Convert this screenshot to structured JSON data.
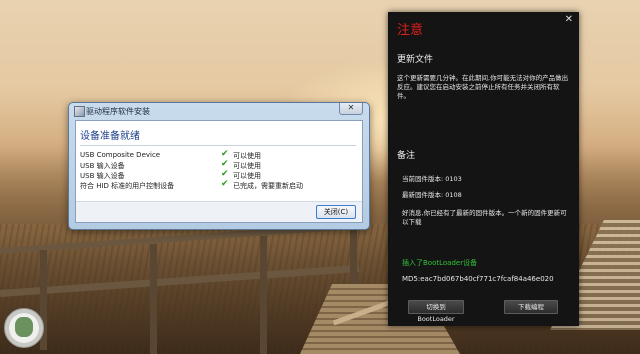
{
  "driver_dialog": {
    "title": "驱动程序软件安装",
    "close_glyph": "✕",
    "heading": "设备准备就绪",
    "devices": [
      {
        "name": "USB Composite Device",
        "status": "可以使用"
      },
      {
        "name": "USB 输入设备",
        "status": "可以使用"
      },
      {
        "name": "USB 输入设备",
        "status": "可以使用"
      },
      {
        "name": "符合 HID 标准的用户控制设备",
        "status": "已完成，需要重新启动"
      }
    ],
    "status_icon": "checkmark-icon",
    "check_glyph": "✔",
    "close_button_label": "关闭(C)"
  },
  "update_panel": {
    "title": "注意",
    "close_glyph": "✕",
    "section_update": "更新文件",
    "update_text": "这个更新需要几分钟。在此期间,你可能无法对你的产品做出反应。建议您在启动安装之前停止所有任务并关闭所有软件。",
    "section_notes": "备注",
    "current_version": "当前固件版本: 0103",
    "latest_version": "最新固件版本: 0108",
    "message": "好消息,你已经有了最新的固件版本。一个新的固件更新可以下载",
    "bootloader_status": "插入了BootLoader设备",
    "md5": "MD5:eac7bd067b40cf771c7fcaf84a46e020",
    "switch_button_label": "切换到BootLoader",
    "download_button_label": "下载编程"
  },
  "colors": {
    "panel_title": "#e41e1e",
    "status_green": "#32c23a",
    "dialog_heading": "#1c3e8a"
  }
}
